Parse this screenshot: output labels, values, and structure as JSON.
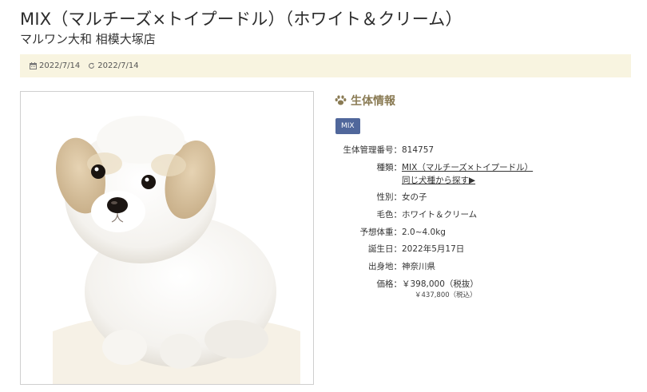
{
  "header": {
    "title": "MIX（マルチーズ×トイプードル）（ホワイト＆クリーム）",
    "store": "マルワン大和 相模大塚店"
  },
  "dates": {
    "posted": "2022/7/14",
    "updated": "2022/7/14"
  },
  "photo": {
    "icon": "puppy-photo"
  },
  "info": {
    "heading": "生体情報",
    "tag": "MIX",
    "fields": {
      "management_number": {
        "label": "生体管理番号：",
        "value": "814757"
      },
      "breed": {
        "label": "種類：",
        "value": "MIX（マルチーズ×トイプードル）",
        "same_breed_link": "同じ犬種から探す▶"
      },
      "sex": {
        "label": "性別：",
        "value": "女の子"
      },
      "color": {
        "label": "毛色：",
        "value": "ホワイト＆クリーム"
      },
      "expected_weight": {
        "label": "予想体重：",
        "value": "2.0~4.0kg"
      },
      "birthday": {
        "label": "誕生日：",
        "value": "2022年5月17日"
      },
      "origin": {
        "label": "出身地：",
        "value": "神奈川県"
      },
      "price": {
        "label": "価格：",
        "value": "￥398,000（税抜）",
        "tax_included": "￥437,800（税込）"
      }
    }
  },
  "colors": {
    "accent": "#8a7b54",
    "tag_bg": "#50679b",
    "date_bar_bg": "#f8f4e0"
  }
}
